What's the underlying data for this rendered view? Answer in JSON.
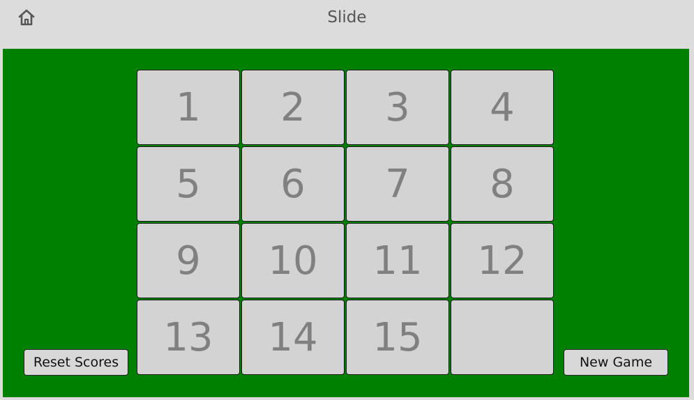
{
  "header": {
    "title": "Slide",
    "home_icon": "home-icon"
  },
  "colors": {
    "board_background": "#008000",
    "tile_background": "#d3d3d3",
    "tile_text": "#808080",
    "topbar_background": "#dcdcdc"
  },
  "board": {
    "rows": 4,
    "cols": 4,
    "tiles": [
      "1",
      "2",
      "3",
      "4",
      "5",
      "6",
      "7",
      "8",
      "9",
      "10",
      "11",
      "12",
      "13",
      "14",
      "15",
      ""
    ]
  },
  "buttons": {
    "reset_label": "Reset Scores",
    "new_game_label": "New Game"
  }
}
